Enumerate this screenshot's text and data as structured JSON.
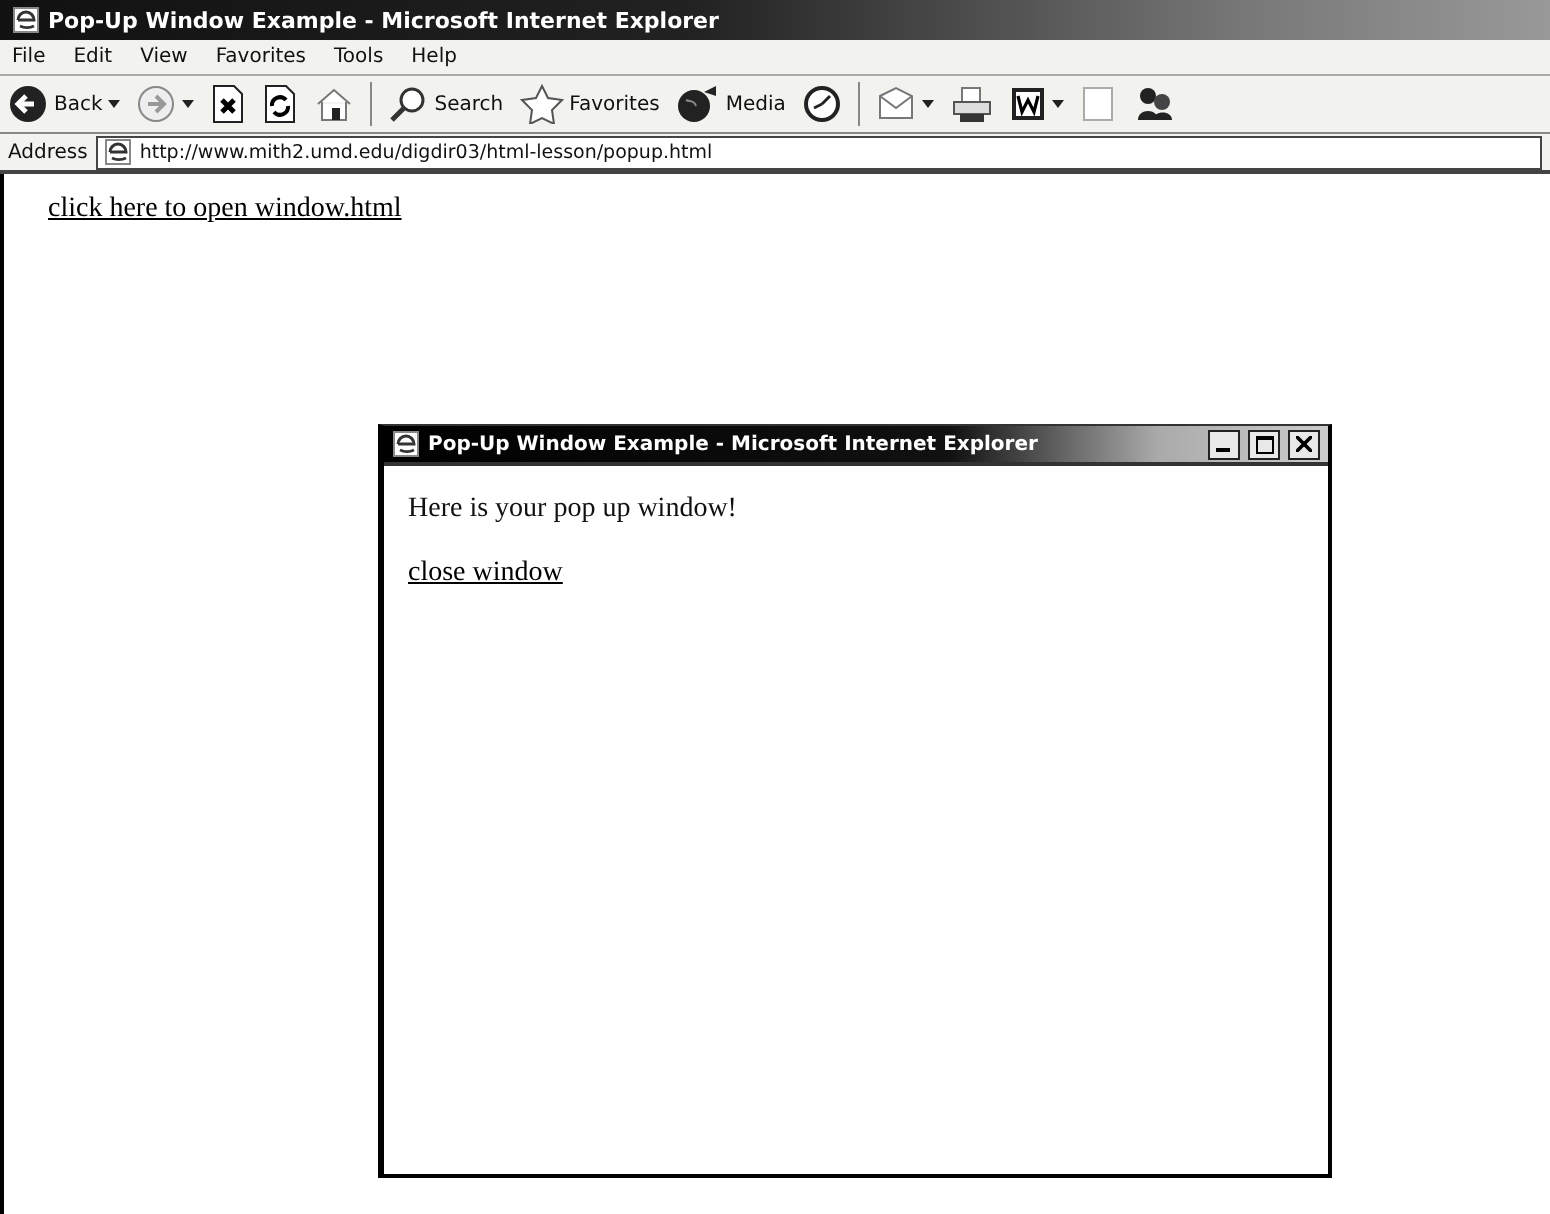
{
  "window": {
    "title": "Pop-Up Window Example - Microsoft Internet Explorer"
  },
  "menu": [
    "File",
    "Edit",
    "View",
    "Favorites",
    "Tools",
    "Help"
  ],
  "toolbar": [
    {
      "label": "Back",
      "menu": true
    },
    {
      "menu": true
    },
    {
      "menu": false
    },
    {
      "menu": false
    },
    {
      "menu": false
    },
    {
      "label": "Search",
      "menu": false
    },
    {
      "label": "Favorites",
      "menu": false
    },
    {
      "label": "Media",
      "menu": false
    },
    {
      "menu": false
    },
    {
      "menu": true
    },
    {
      "menu": false
    },
    {
      "menu": true
    },
    {
      "menu": false
    },
    {
      "menu": false
    }
  ],
  "address": {
    "label": "Address",
    "value": "http://www.mith2.umd.edu/digdir03/html-lesson/popup.html"
  },
  "page": {
    "link": "click here to open window.html"
  },
  "popup": {
    "title": "Pop-Up Window Example - Microsoft Internet Explorer",
    "text": "Here is your pop up window!",
    "link": "close window"
  }
}
